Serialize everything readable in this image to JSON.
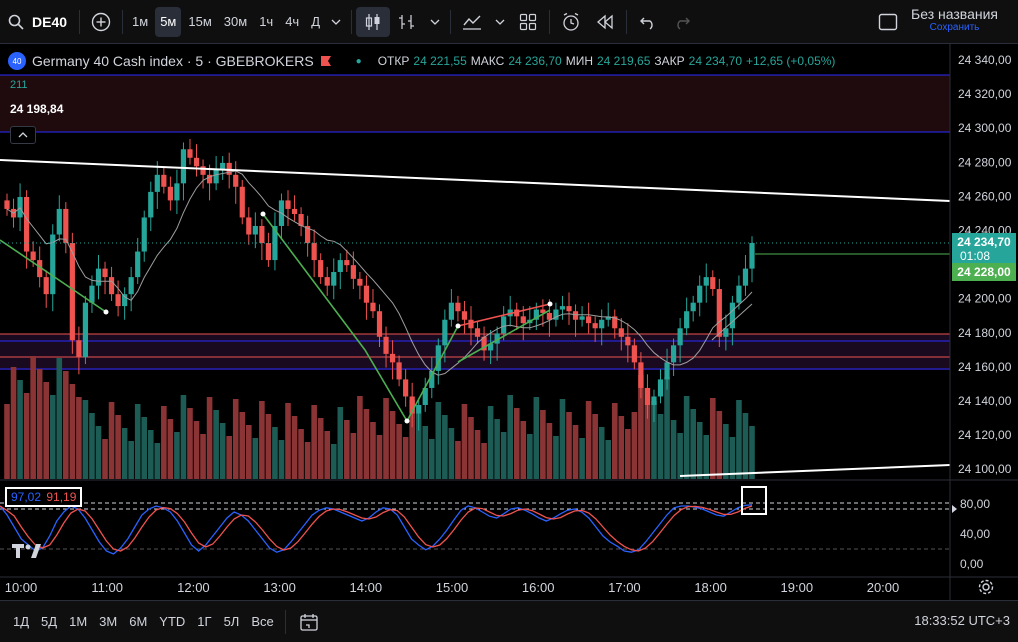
{
  "toolbar": {
    "symbol": "DE40",
    "timeframes": [
      "1м",
      "5м",
      "15м",
      "30м",
      "1ч",
      "4ч",
      "Д"
    ],
    "active_timeframe": "5м",
    "layout_name": "Без названия",
    "layout_status": "Сохранить"
  },
  "legend": {
    "badge": "40",
    "title": "Germany 40 Cash index · 5 · GBEBROKERS",
    "open_label": "ОТКР",
    "open": "24 221,55",
    "high_label": "МАКС",
    "high": "24 236,70",
    "low_label": "МИН",
    "low": "24 219,65",
    "close_label": "ЗАКР",
    "close": "24 234,70",
    "change": "+12,65 (+0,05%)",
    "volume": "211",
    "cursor_price": "24 198,84"
  },
  "price_axis": {
    "ticks": [
      "24 340,00",
      "24 320,00",
      "24 300,00",
      "24 280,00",
      "24 260,00",
      "24 240,00",
      "24 220,00",
      "24 200,00",
      "24 180,00",
      "24 160,00",
      "24 140,00",
      "24 120,00",
      "24 100,00"
    ],
    "last_price": "24 234,70",
    "countdown": "01:08",
    "line_price": "24 228,00"
  },
  "oscillator": {
    "k_value": "97,02",
    "d_value": "91,19",
    "ticks": [
      "80,00",
      "40,00",
      "0,00"
    ]
  },
  "time_axis": {
    "ticks": [
      "10:00",
      "11:00",
      "12:00",
      "13:00",
      "14:00",
      "15:00",
      "16:00",
      "17:00",
      "18:00",
      "19:00",
      "20:00"
    ]
  },
  "bottombar": {
    "ranges": [
      "1Д",
      "5Д",
      "1М",
      "3М",
      "6М",
      "YTD",
      "1Г",
      "5Л",
      "Все"
    ],
    "clock": "18:33:52 UTC+3"
  },
  "colors": {
    "up": "#26a69a",
    "down": "#ef5350",
    "accent": "#2962ff"
  }
}
